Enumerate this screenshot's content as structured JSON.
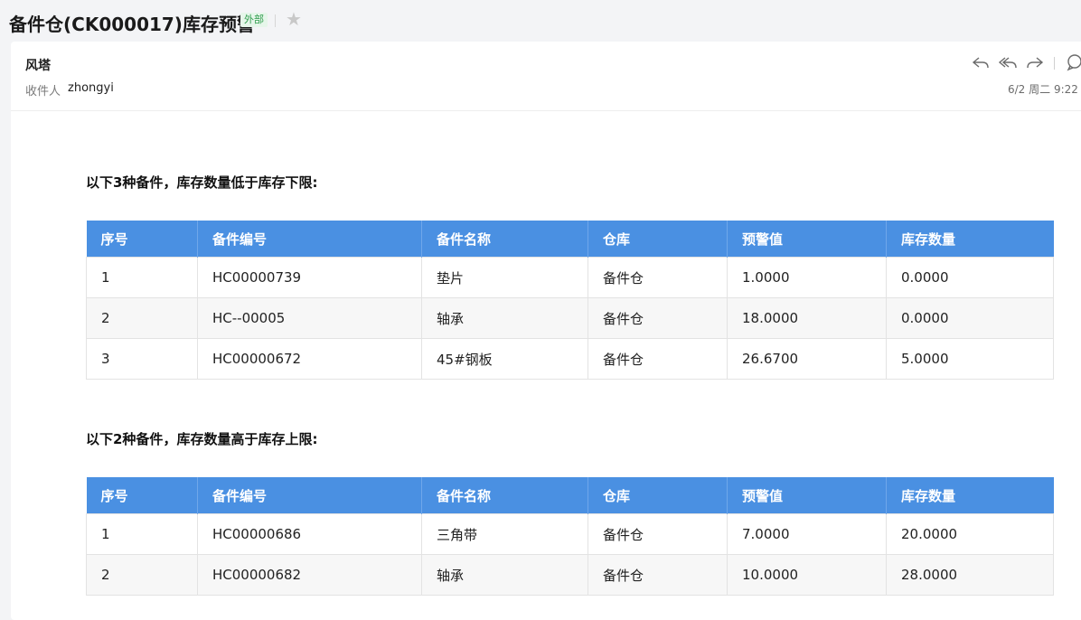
{
  "email": {
    "subject": "备件仓(CK000017)库存预警",
    "tag": "外部",
    "sender": "风塔",
    "recipient_label": "收件人",
    "recipient": "zhongyi",
    "date": "6/2 周二 9:22"
  },
  "toolbar": {
    "icons": [
      "reply-icon",
      "reply-all-icon",
      "forward-icon",
      "comment-icon"
    ]
  },
  "sections": [
    {
      "title": "以下3种备件，库存数量低于库存下限:",
      "headers": [
        "序号",
        "备件编号",
        "备件名称",
        "仓库",
        "预警值",
        "库存数量"
      ],
      "rows": [
        [
          "1",
          "HC00000739",
          "垫片",
          "备件仓",
          "1.0000",
          "0.0000"
        ],
        [
          "2",
          "HC--00005",
          "轴承",
          "备件仓",
          "18.0000",
          "0.0000"
        ],
        [
          "3",
          "HC00000672",
          "45#钢板",
          "备件仓",
          "26.6700",
          "5.0000"
        ]
      ]
    },
    {
      "title": "以下2种备件，库存数量高于库存上限:",
      "headers": [
        "序号",
        "备件编号",
        "备件名称",
        "仓库",
        "预警值",
        "库存数量"
      ],
      "rows": [
        [
          "1",
          "HC00000686",
          "三角带",
          "备件仓",
          "7.0000",
          "20.0000"
        ],
        [
          "2",
          "HC00000682",
          "轴承",
          "备件仓",
          "10.0000",
          "28.0000"
        ]
      ]
    }
  ],
  "colors": {
    "table_header": "#4a90e2",
    "tag_text": "#2e9c4c",
    "tag_bg": "#e6f6ea"
  }
}
